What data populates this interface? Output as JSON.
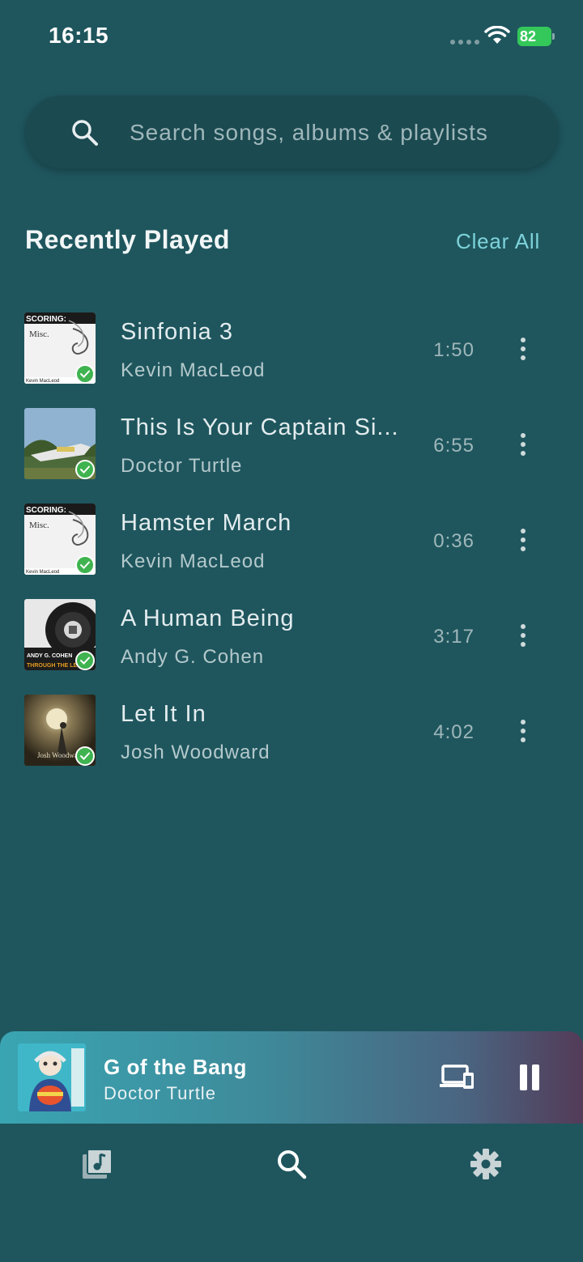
{
  "status_bar": {
    "time": "16:15",
    "battery": "82"
  },
  "search": {
    "placeholder": "Search songs, albums & playlists"
  },
  "recent": {
    "title": "Recently Played",
    "clear_label": "Clear All",
    "tracks": [
      {
        "title": "Sinfonia 3",
        "artist": "Kevin MacLeod",
        "duration": "1:50"
      },
      {
        "title": "This Is Your Captain Si...",
        "artist": "Doctor Turtle",
        "duration": "6:55"
      },
      {
        "title": "Hamster March",
        "artist": "Kevin MacLeod",
        "duration": "0:36"
      },
      {
        "title": "A Human Being",
        "artist": "Andy G. Cohen",
        "duration": "3:17"
      },
      {
        "title": "Let It In",
        "artist": "Josh Woodward",
        "duration": "4:02"
      }
    ]
  },
  "cover_text": {
    "scoring": "SCORING:",
    "misc": "Misc.",
    "kevin": "Kevin MacLeod",
    "andy": "ANDY G. COHEN",
    "lens": "THROUGH THE LENS",
    "josh": "Josh Woodward"
  },
  "now_playing": {
    "title": "G of the Bang",
    "artist": "Doctor Turtle"
  },
  "colors": {
    "background": "#1f565e",
    "accent": "#7ed3da",
    "downloaded_badge": "#3fb34f"
  },
  "icons": {
    "search": "search-icon",
    "more": "more-vertical-icon",
    "devices": "devices-icon",
    "pause": "pause-icon",
    "library": "library-music-icon",
    "settings": "gear-icon"
  }
}
